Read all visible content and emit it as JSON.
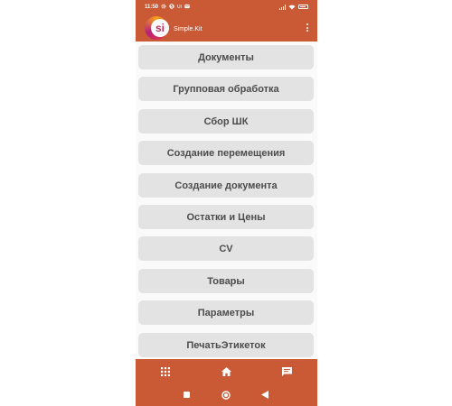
{
  "status_bar": {
    "time": "11:50",
    "icons": [
      "gear-icon",
      "s-app-icon",
      "ui-label",
      "mail-icon"
    ],
    "ui_label": "UI",
    "right_icons": [
      "signal-icon",
      "wifi-icon",
      "battery-icon"
    ]
  },
  "app_bar": {
    "logo_text": "si",
    "title": "Simple.Kit",
    "menu_icon": "more-vert-icon"
  },
  "menu": {
    "items": [
      {
        "label": "Документы"
      },
      {
        "label": "Групповая обработка"
      },
      {
        "label": "Сбор ШК"
      },
      {
        "label": "Создание перемещения"
      },
      {
        "label": "Создание документа"
      },
      {
        "label": "Остатки и Цены"
      },
      {
        "label": "CV"
      },
      {
        "label": "Товары"
      },
      {
        "label": "Параметры"
      },
      {
        "label": "ПечатьЭтикеток"
      }
    ]
  },
  "bottom_nav": {
    "items": [
      "apps-grid-icon",
      "home-icon",
      "chat-icon"
    ]
  },
  "system_nav": {
    "items": [
      "recents-icon",
      "home-circle-icon",
      "back-icon"
    ]
  },
  "colors": {
    "primary": "#c95a35",
    "button_bg": "#e3e3e3",
    "button_text": "#4c4c4c",
    "background": "#fafafa"
  }
}
